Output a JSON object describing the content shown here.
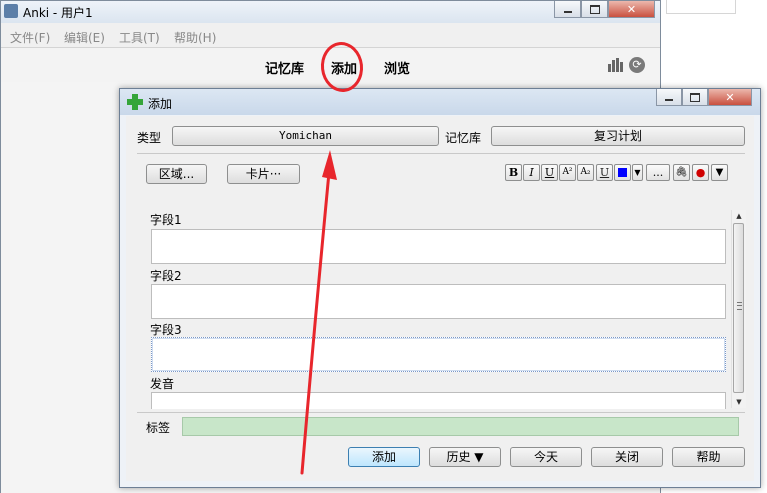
{
  "main_window": {
    "title": "Anki - 用户1",
    "menu": [
      "文件(F)",
      "编辑(E)",
      "工具(T)",
      "帮助(H)"
    ],
    "toolbar": {
      "decks": "记忆库",
      "add": "添加",
      "browse": "浏览"
    },
    "sync_glyph": "⟳"
  },
  "add_dialog": {
    "title": "添加",
    "type_label": "类型",
    "note_type": "Yomichan",
    "deck_label": "记忆库",
    "deck": "复习计划",
    "fields_button": "区域...",
    "cards_button": "卡片···",
    "format_buttons": {
      "bold": "B",
      "italic": "I",
      "underline": "U",
      "superscript": "A²",
      "subscript": "A₂",
      "clear": "U",
      "dropdown": "▼",
      "more": "...",
      "attach": "🖇",
      "record": "●",
      "options": "▼"
    },
    "text_color": "#0000ff",
    "fields": [
      {
        "name": "字段1",
        "value": ""
      },
      {
        "name": "字段2",
        "value": ""
      },
      {
        "name": "字段3",
        "value": ""
      },
      {
        "name": "发音",
        "value": ""
      }
    ],
    "tags_label": "标签",
    "tags_value": "",
    "buttons": {
      "add": "添加",
      "history": "历史 ▼",
      "today": "今天",
      "close": "关闭",
      "help": "帮助"
    }
  },
  "annotations": {
    "color": "#e8262c"
  }
}
